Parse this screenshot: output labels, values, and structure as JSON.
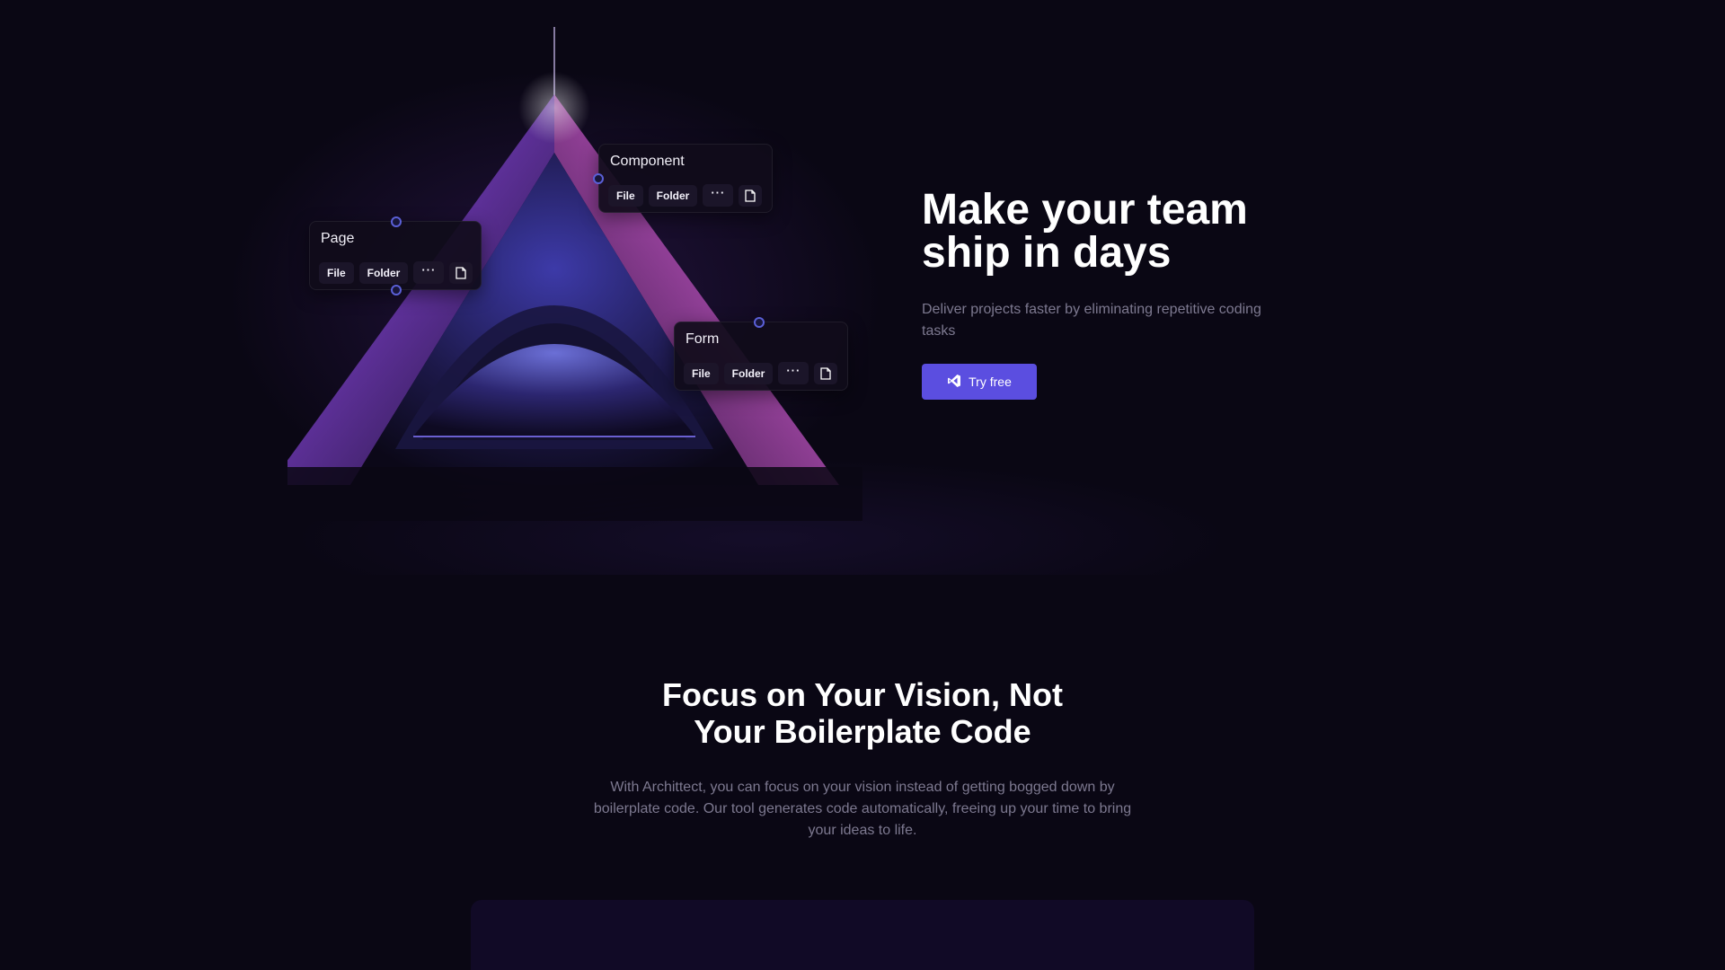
{
  "hero": {
    "title_line1": "Make your team",
    "title_line2": "ship in days",
    "subtitle": "Deliver projects faster by eliminating repetitive coding tasks",
    "cta_label": "Try free",
    "cta_icon": "vscode-icon"
  },
  "node_cards": [
    {
      "title": "Page",
      "file_label": "File",
      "folder_label": "Folder",
      "more_label": "···",
      "doc_icon": "document-icon"
    },
    {
      "title": "Component",
      "file_label": "File",
      "folder_label": "Folder",
      "more_label": "···",
      "doc_icon": "document-icon"
    },
    {
      "title": "Form",
      "file_label": "File",
      "folder_label": "Folder",
      "more_label": "···",
      "doc_icon": "document-icon"
    }
  ],
  "section": {
    "title_line1": "Focus on Your Vision, Not",
    "title_line2": "Your Boilerplate Code",
    "body_line1": "With Archittect, you can focus on your vision instead of getting bogged down by",
    "body_line2": "boilerplate code. Our tool generates code automatically, freeing up your time to bring",
    "body_line3": "your ideas to life."
  },
  "colors": {
    "background": "#0a0714",
    "accent": "#5b4ee0",
    "muted_text": "#7d7990",
    "panel": "#110a26"
  }
}
